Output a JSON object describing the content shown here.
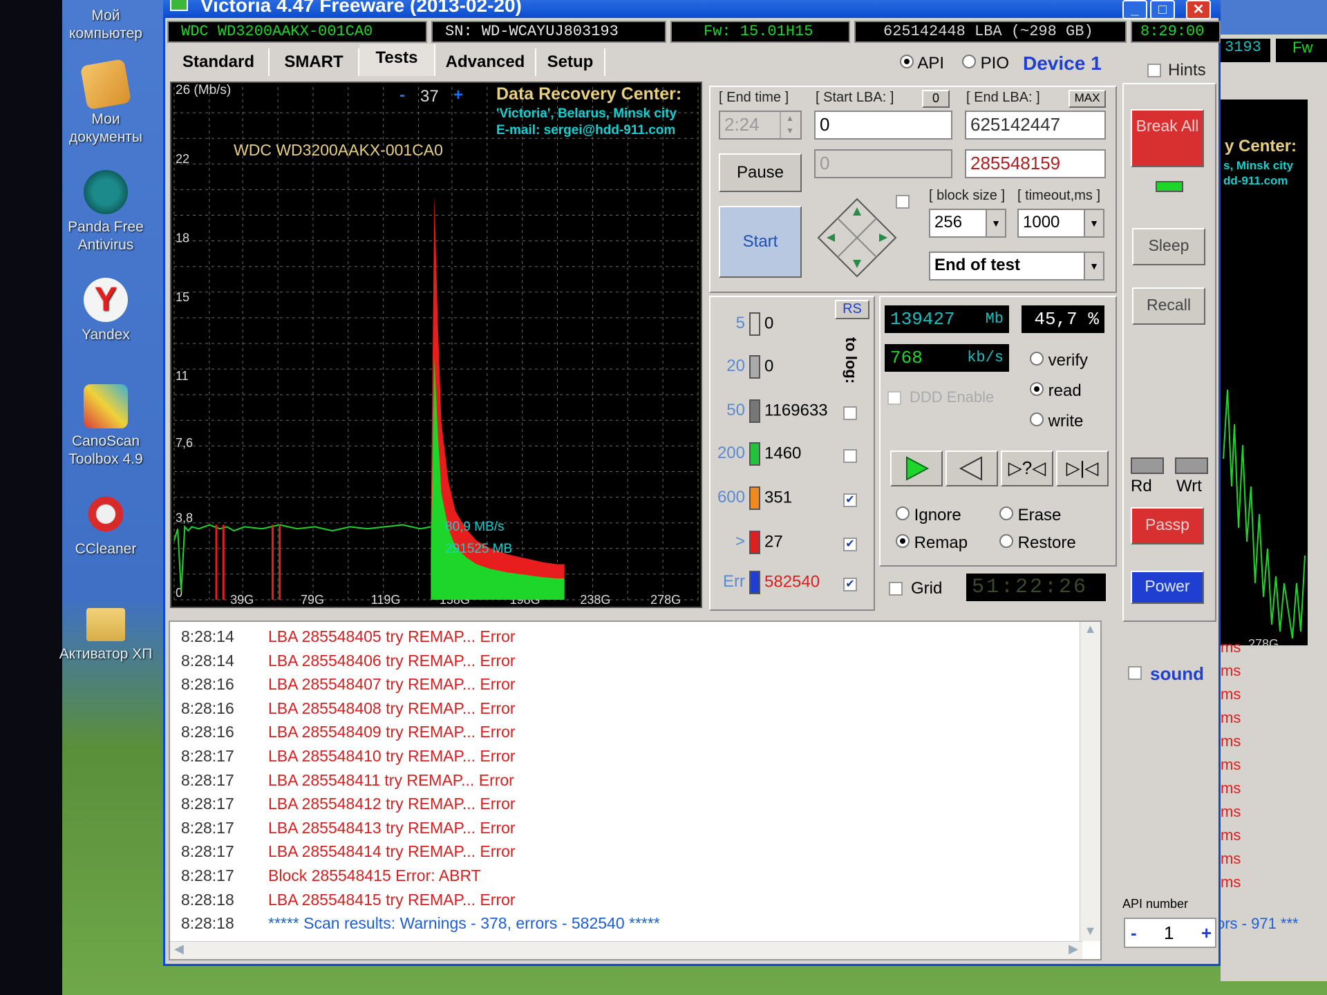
{
  "desktop": {
    "icons": [
      {
        "label": "Мой компьютер",
        "icon": "computer-icon"
      },
      {
        "label": "Мои документы",
        "icon": "documents-icon"
      },
      {
        "label": "Panda Free Antivirus",
        "icon": "panda-icon"
      },
      {
        "label": "Yandex",
        "icon": "yandex-icon"
      },
      {
        "label": "CanoScan Toolbox 4.9",
        "icon": "scanner-icon"
      },
      {
        "label": "CCleaner",
        "icon": "ccleaner-icon"
      },
      {
        "label": "Активатор ХП",
        "icon": "folder-icon"
      }
    ]
  },
  "window": {
    "title": "Victoria 4.47  Freeware (2013-02-20)",
    "controls": {
      "minimize": "_",
      "maximize": "□",
      "close": "✕"
    }
  },
  "info": {
    "model": "WDC WD3200AAKX-001CA0",
    "serial": "SN: WD-WCAYUJ803193",
    "firmware": "Fw: 15.01H15",
    "lba": "625142448 LBA (~298 GB)",
    "clock": "8:29:00"
  },
  "tabs": [
    "Standard",
    "SMART",
    "Tests",
    "Advanced",
    "Setup"
  ],
  "active_tab": "Tests",
  "mode": {
    "api": "API",
    "pio": "PIO",
    "device": "Device 1",
    "hints": "Hints"
  },
  "chart_data": {
    "type": "line",
    "title": "WDC WD3200AAKX-001CA0",
    "ylabel": "26 (Mb/s)",
    "y_ticks": [
      "26 (Mb/s)",
      "22",
      "18",
      "15",
      "11",
      "7,6",
      "3,8",
      "0"
    ],
    "x_ticks": [
      "39G",
      "79G",
      "119G",
      "158G",
      "198G",
      "238G",
      "278G"
    ],
    "ylim": [
      0,
      26
    ],
    "xlim": [
      0,
      298
    ],
    "scale_control": {
      "minus": "-",
      "value": "37",
      "plus": "+"
    },
    "credit": {
      "heading": "Data Recovery Center:",
      "line1": "'Victoria', Belarus, Minsk city",
      "line2": "E-mail: sergei@hdd-911.com"
    },
    "annotation_speed": "80,9 MB/s",
    "annotation_position": "291525 MB",
    "series": [
      {
        "values_x": [
          0,
          2,
          4,
          6,
          8,
          10,
          14,
          20,
          26,
          30,
          34,
          40,
          50,
          60,
          70,
          80,
          90,
          100,
          110,
          120,
          130,
          140,
          146
        ],
        "values_y": [
          3.0,
          3.6,
          0.4,
          3.7,
          3.5,
          3.7,
          3.6,
          3.8,
          3.6,
          3.7,
          3.5,
          3.7,
          3.6,
          3.8,
          3.6,
          3.7,
          3.5,
          3.7,
          3.6,
          3.7,
          3.8,
          3.6,
          3.7
        ]
      },
      {
        "values_x": [
          146,
          148,
          150,
          152,
          156,
          160,
          166,
          172,
          180,
          190,
          200,
          210,
          218,
          222
        ],
        "values_y": [
          3.7,
          20.5,
          14.0,
          9.0,
          6.0,
          4.5,
          3.6,
          3.0,
          2.6,
          2.3,
          2.1,
          1.9,
          1.8,
          1.8
        ]
      }
    ],
    "error_marks_x": [
      24,
      28,
      56,
      60
    ]
  },
  "controls": {
    "end_time_label": "[ End time ]",
    "end_time": "2:24",
    "start_lba_label": "[ Start LBA: ]",
    "start_lba_btn": "0",
    "start_lba": "0",
    "cur_lba": "0",
    "end_lba_label": "[ End LBA: ]",
    "end_lba_btn": "MAX",
    "end_lba": "625142447",
    "cur_end": "285548159",
    "pause": "Pause",
    "start": "Start",
    "block_size_label": "[ block size ]",
    "block_size": "256",
    "timeout_label": "[ timeout,ms ]",
    "timeout": "1000",
    "end_action": "End of test"
  },
  "stats": {
    "rs": "RS",
    "to_log": "to log:",
    "rows": [
      {
        "ms": "5",
        "count": "0",
        "color": "#d6d3ce",
        "checked": false
      },
      {
        "ms": "20",
        "count": "0",
        "color": "#aaaaaa",
        "checked": false
      },
      {
        "ms": "50",
        "count": "1169633",
        "color": "#777777",
        "checked": false
      },
      {
        "ms": "200",
        "count": "1460",
        "color": "#22c33a",
        "checked": false
      },
      {
        "ms": "600",
        "count": "351",
        "color": "#f08a1e",
        "checked": true
      },
      {
        "ms": ">",
        "count": "27",
        "color": "#e01e1e",
        "checked": true
      },
      {
        "ms": "Err",
        "count": "582540",
        "color": "#1f3fd0",
        "checked": true
      }
    ]
  },
  "progress": {
    "mb": "139427",
    "mb_unit": "Mb",
    "percent": "45,7  %",
    "speed": "768",
    "speed_unit": "kb/s",
    "ddd": "DDD Enable",
    "verify": "verify",
    "read": "read",
    "write": "write",
    "mode_selected": "read"
  },
  "actions": {
    "ignore": "Ignore",
    "erase": "Erase",
    "remap": "Remap",
    "restore": "Restore",
    "selected": "Remap",
    "grid": "Grid",
    "timer": "51:22:26"
  },
  "right_panel": {
    "break_all": "Break All",
    "sleep": "Sleep",
    "recall": "Recall",
    "rd": "Rd",
    "wrt": "Wrt",
    "passp": "Passp",
    "power": "Power",
    "sound": "sound",
    "api_number_label": "API number",
    "api_number": "1",
    "api_minus": "-",
    "api_plus": "+"
  },
  "log": [
    {
      "time": "8:28:14",
      "msg": "LBA 285548405 try REMAP... Error",
      "kind": "error"
    },
    {
      "time": "8:28:14",
      "msg": "LBA 285548406 try REMAP... Error",
      "kind": "error"
    },
    {
      "time": "8:28:16",
      "msg": "LBA 285548407 try REMAP... Error",
      "kind": "error"
    },
    {
      "time": "8:28:16",
      "msg": "LBA 285548408 try REMAP... Error",
      "kind": "error"
    },
    {
      "time": "8:28:16",
      "msg": "LBA 285548409 try REMAP... Error",
      "kind": "error"
    },
    {
      "time": "8:28:17",
      "msg": "LBA 285548410 try REMAP... Error",
      "kind": "error"
    },
    {
      "time": "8:28:17",
      "msg": "LBA 285548411 try REMAP... Error",
      "kind": "error"
    },
    {
      "time": "8:28:17",
      "msg": "LBA 285548412 try REMAP... Error",
      "kind": "error"
    },
    {
      "time": "8:28:17",
      "msg": "LBA 285548413 try REMAP... Error",
      "kind": "error"
    },
    {
      "time": "8:28:17",
      "msg": "LBA 285548414 try REMAP... Error",
      "kind": "error"
    },
    {
      "time": "8:28:17",
      "msg": "Block 285548415 Error: ABRT",
      "kind": "error"
    },
    {
      "time": "8:28:18",
      "msg": "LBA 285548415 try REMAP... Error",
      "kind": "error"
    },
    {
      "time": "8:28:18",
      "msg": "***** Scan results: Warnings - 378, errors - 582540 *****",
      "kind": "info"
    }
  ],
  "background_window": {
    "serial_fragment": "3193",
    "fw_fragment": "Fw",
    "center_fragment": "y Center:",
    "city_fragment": "s, Minsk city",
    "mail_fragment": "dd-911.com",
    "tick_fragment": "278G",
    "log_fragment": "ms",
    "errors_fragment": "ors - 971 ***"
  },
  "colors": {
    "error_text": "#d62020",
    "info_text": "#1c5ed8",
    "grid_line": "#6b6b6b",
    "speed_fill_red": "#e81e1e",
    "speed_fill_green": "#1ed62a",
    "cyan_text": "#18d0d0"
  }
}
